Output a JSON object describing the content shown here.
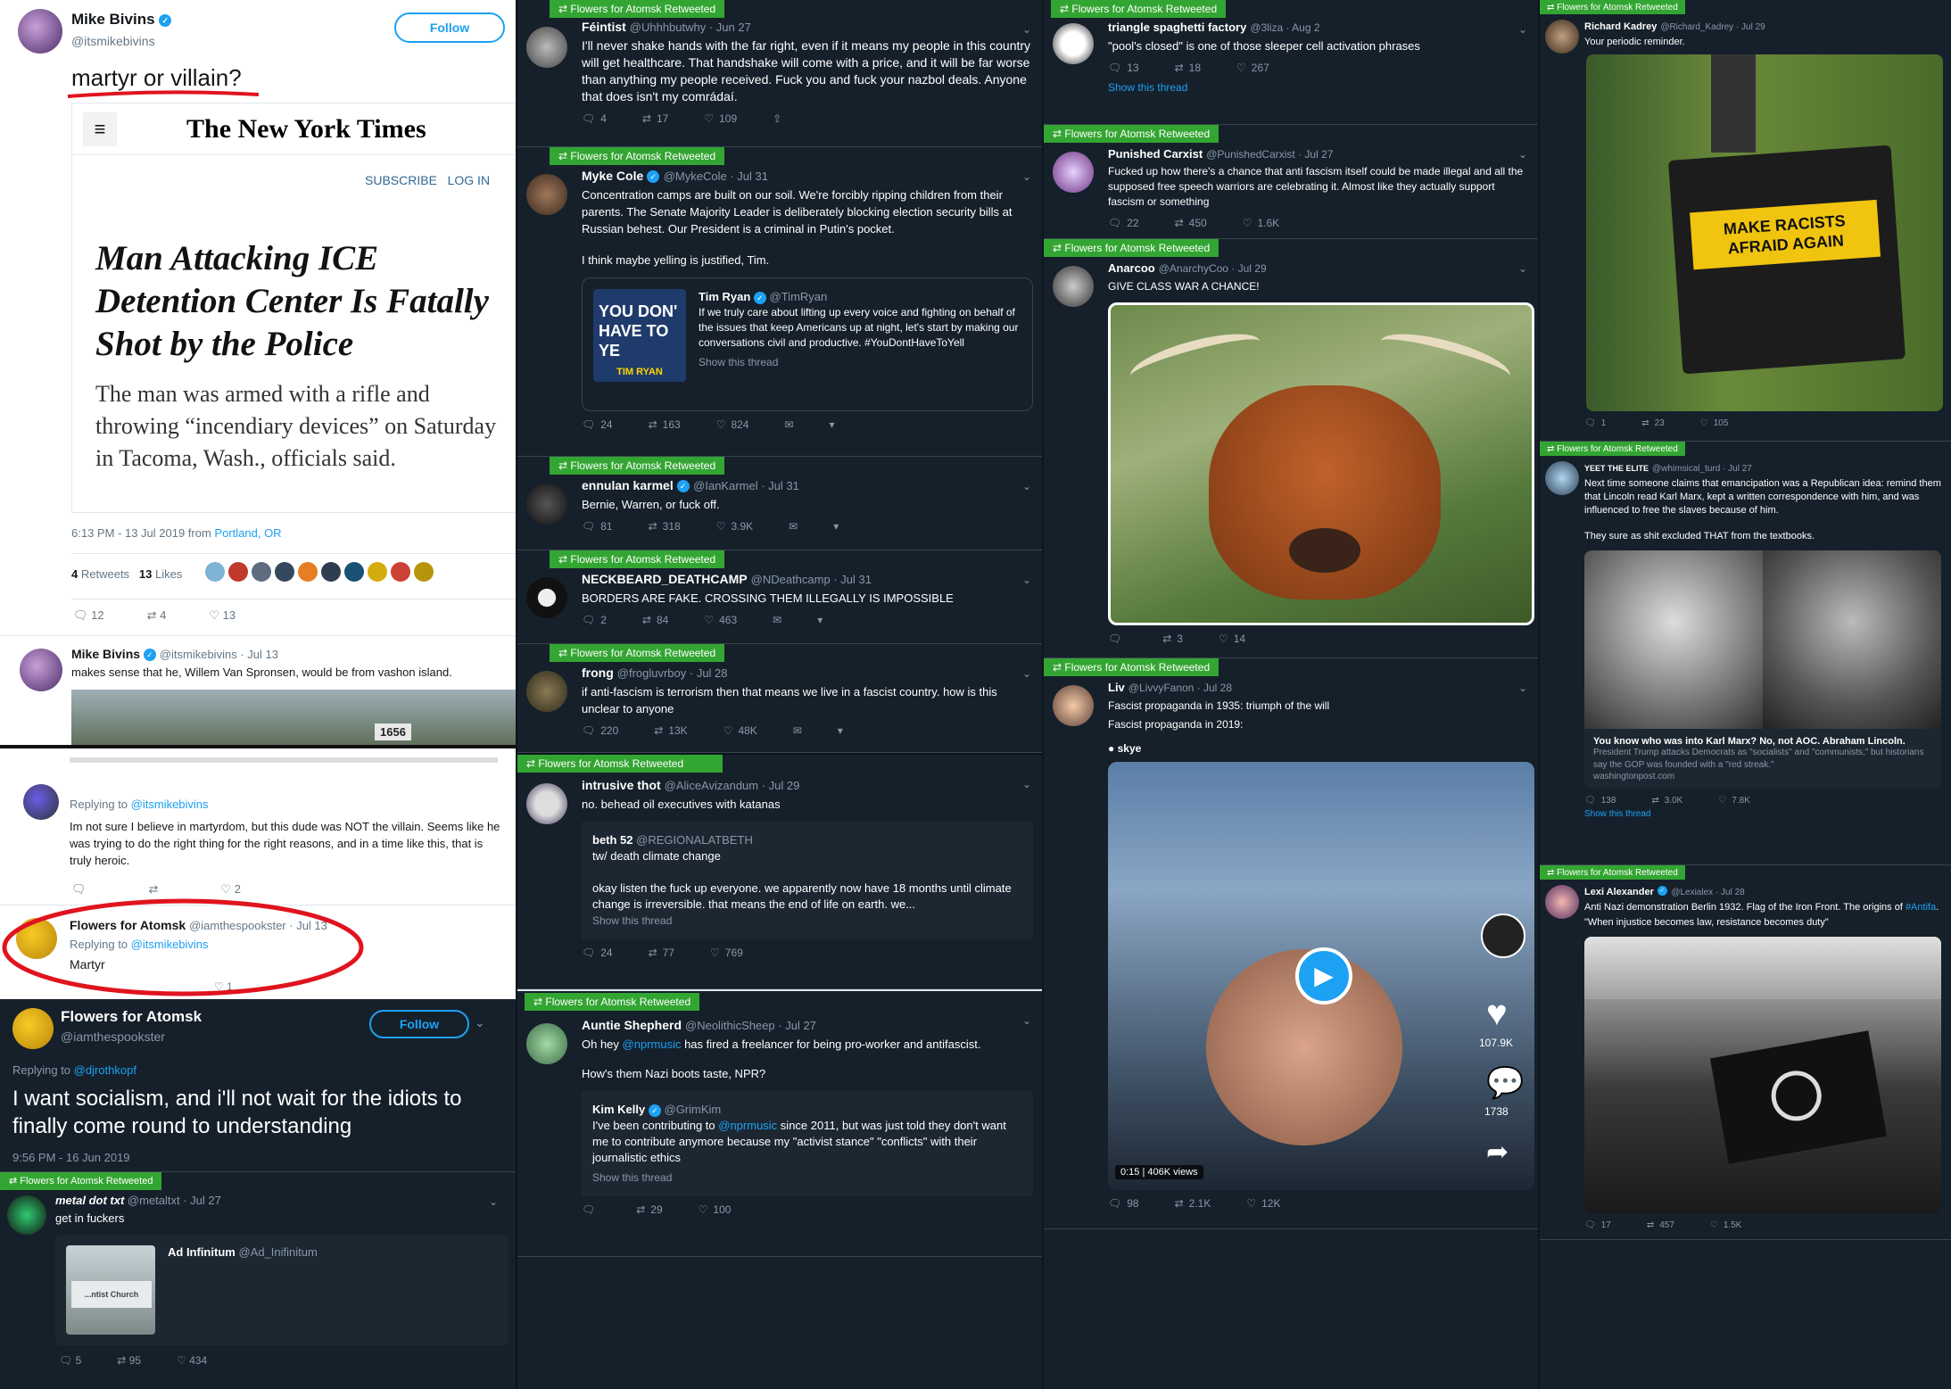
{
  "col1": {
    "top": {
      "name": "Mike Bivins",
      "handle": "@itsmikebivins",
      "follow": "Follow",
      "text": "martyr or villain?",
      "nyt": {
        "logo": "The New York Times",
        "subscribe": "SUBSCRIBE",
        "login": "LOG IN",
        "headline": "Man Attacking ICE Detention Center Is Fatally Shot by the Police",
        "sub": "The man was armed with a rifle and throwing “incendiary devices” on Saturday in Tacoma, Wash., officials said."
      },
      "time": "6:13 PM - 13 Jul 2019 from ",
      "place": "Portland, OR",
      "retweets": "4",
      "retweets_label": "Retweets",
      "likes": "13",
      "likes_label": "Likes",
      "reply": "12",
      "rt": "4",
      "like": "13"
    },
    "reply1": {
      "name": "Mike Bivins",
      "handle": "@itsmikebivins · Jul 13",
      "text": "makes sense that he, Willem Van Spronsen, would be from vashon island.",
      "sign": "1656"
    },
    "reply2": {
      "replying": "Replying to ",
      "to": "@itsmikebivins",
      "text": "Im not sure I believe in martyrdom, but this dude was NOT the villain. Seems like he was trying to do the right thing for the right reasons, and in a time like this, that is truly heroic.",
      "likes": "2"
    },
    "reply3": {
      "name": "Flowers for Atomsk",
      "handle": "@iamthespookster · Jul 13",
      "replying": "Replying to ",
      "to": "@itsmikebivins",
      "text": "Martyr",
      "likes": "1"
    },
    "profile": {
      "name": "Flowers for Atomsk",
      "handle": "@iamthespookster",
      "follow": "Follow",
      "replying": "Replying to ",
      "to": "@djrothkopf",
      "text": "I want socialism, and i'll not wait for the idiots to finally come round to understanding",
      "time": "9:56 PM - 16 Jun 2019"
    },
    "metal": {
      "rt": "Flowers for Atomsk Retweeted",
      "name": "metal dot txt",
      "handle": "@metaltxt · Jul 27",
      "text": "get in fuckers",
      "card_name": "Ad Infinitum",
      "card_handle": "@Ad_Inifinitum",
      "bus": "...ntist Church",
      "reply": "5",
      "retweet": "95",
      "like": "434"
    }
  },
  "col2": [
    {
      "rt": "Flowers for Atomsk Retweeted",
      "name": "Féintist",
      "handle": "@Uhhhbutwhy · Jun 27",
      "text": "I'll never shake hands with the far right, even if it means my people in this country will get healthcare. That handshake will come with a price, and it will be far worse than anything my people received. Fuck you and fuck your nazbol deals. Anyone that does isn't my comrádaí.",
      "reply": "4",
      "retweet": "17",
      "like": "109"
    },
    {
      "rt": "Flowers for Atomsk Retweeted",
      "name": "Myke Cole",
      "handle": "@MykeCole · Jul 31",
      "text": "Concentration camps are built on our soil. We're forcibly ripping children from their parents. The Senate Majority Leader is deliberately blocking election security bills at Russian behest. Our President is a criminal in Putin's pocket.",
      "text2": "I think maybe yelling is justified, Tim.",
      "q_name": "Tim Ryan",
      "q_handle": "@TimRyan",
      "q_text": "If we truly care about lifting up every voice and fighting on behalf of the issues that keep Americans up at night, let's start by making our conversations civil and productive. #YouDontHaveToYell",
      "q_show": "Show this thread",
      "q_img": "YOU DON' HAVE TO YE",
      "q_img2": "TIM RYAN",
      "reply": "24",
      "retweet": "163",
      "like": "824"
    },
    {
      "rt": "Flowers for Atomsk Retweeted",
      "name": "ennulan karmel",
      "handle": "@IanKarmel · Jul 31",
      "text": "Bernie, Warren, or fuck off.",
      "reply": "81",
      "retweet": "318",
      "like": "3.9K"
    },
    {
      "rt": "Flowers for Atomsk Retweeted",
      "name": "NECKBEARD_DEATHCAMP",
      "handle": "@NDeathcamp · Jul 31",
      "text": "BORDERS ARE FAKE. CROSSING THEM ILLEGALLY IS IMPOSSIBLE",
      "reply": "2",
      "retweet": "84",
      "like": "463"
    },
    {
      "rt": "Flowers for Atomsk Retweeted",
      "name": "frong",
      "handle": "@frogluvrboy · Jul 28",
      "text": "if anti-fascism is terrorism then that means we live in a fascist country. how is this unclear to anyone",
      "reply": "220",
      "retweet": "13K",
      "like": "48K"
    },
    {
      "rt": "Flowers for Atomsk Retweeted",
      "name": "intrusive thot",
      "handle": "@AliceAvizandum · Jul 29",
      "text": "no. behead oil executives with katanas",
      "q_name": "beth 52",
      "q_handle": "@REGIONALATBETH",
      "q_text": "tw/ death climate change",
      "q_text2": "okay listen the fuck up everyone. we apparently now have 18 months until climate change is irreversible. that means the end of life on earth. we...",
      "q_show": "Show this thread",
      "reply": "24",
      "retweet": "77",
      "like": "769"
    },
    {
      "rt": "Flowers for Atomsk Retweeted",
      "name": "Auntie Shepherd",
      "handle": "@NeolithicSheep · Jul 27",
      "text_a": "Oh hey ",
      "text_link": "@nprmusic",
      "text_b": " has fired a freelancer for being pro-worker and antifascist.",
      "text2": "How's them Nazi boots taste, NPR?",
      "q_name": "Kim Kelly",
      "q_handle": "@GrimKim",
      "q_text_a": "I've been contributing to ",
      "q_link": "@nprmusic",
      "q_text_b": " since 2011, but was just told they don't want me to contribute anymore because my \"activist stance\" \"conflicts\" with their journalistic ethics",
      "q_show": "Show this thread",
      "reply": "",
      "retweet": "29",
      "like": "100"
    }
  ],
  "col3": [
    {
      "rt": "Flowers for Atomsk Retweeted",
      "name": "triangle spaghetti factory",
      "handle": "@3liza · Aug 2",
      "text": "\"pool's closed\" is one of those sleeper cell activation phrases",
      "reply": "13",
      "retweet": "18",
      "like": "267",
      "show": "Show this thread"
    },
    {
      "rt": "Flowers for Atomsk Retweeted",
      "name": "Punished Carxist",
      "handle": "@PunishedCarxist · Jul 27",
      "text": "Fucked up how there's a chance that anti fascism itself could be made illegal and all the supposed free speech warriors are celebrating it. Almost like they actually support fascism or something",
      "reply": "22",
      "retweet": "450",
      "like": "1.6K"
    },
    {
      "rt": "Flowers for Atomsk Retweeted",
      "name": "Anarcoo",
      "handle": "@AnarchyCoo · Jul 29",
      "text": "GIVE CLASS WAR A CHANCE!",
      "reply": "",
      "retweet": "3",
      "like": "14"
    },
    {
      "rt": "Flowers for Atomsk Retweeted",
      "name": "Liv",
      "handle": "@LivvyFanon · Jul 28",
      "text": "Fascist propaganda in 1935: triumph of the will",
      "text2": "Fascist propaganda in 2019:",
      "tag": "skye",
      "likes_v": "107.9K",
      "comments_v": "1738",
      "time_v": "0:15",
      "views_v": "406K views",
      "reply": "98",
      "retweet": "2.1K",
      "like": "12K"
    }
  ],
  "col4": [
    {
      "rt": "Flowers for Atomsk Retweeted",
      "name": "Richard Kadrey",
      "handle": "@Richard_Kadrey · Jul 29",
      "text": "Your periodic reminder.",
      "sticker": "MAKE RACISTS AFRAID AGAIN",
      "reply": "1",
      "retweet": "23",
      "like": "105"
    },
    {
      "rt": "Flowers for Atomsk Retweeted",
      "name": "YEET THE ELITE",
      "handle": "@whimsical_turd · Jul 27",
      "text": "Next time someone claims that emancipation was a Republican idea: remind them that Lincoln read Karl Marx, kept a written correspondence with him, and was influenced to free the slaves because of him.",
      "text2": "They sure as shit excluded THAT from the textbooks.",
      "card_title": "You know who was into Karl Marx? No, not AOC. Abraham Lincoln.",
      "card_desc": "President Trump attacks Democrats as \"socialists\" and \"communists,\" but historians say the GOP was founded with a \"red streak.\"",
      "card_url": "washingtonpost.com",
      "reply": "138",
      "retweet": "3.0K",
      "like": "7.8K",
      "show": "Show this thread"
    },
    {
      "rt": "Flowers for Atomsk Retweeted",
      "name": "Lexi Alexander",
      "handle": "@Lexialex · Jul 28",
      "text_a": "Anti Nazi demonstration Berlin 1932. Flag of the Iron Front. The origins of ",
      "text_link": "#Antifa",
      "text_b": ".",
      "text2": "\"When injustice becomes law, resistance becomes duty\"",
      "reply": "17",
      "retweet": "457",
      "like": "1.5K"
    }
  ]
}
